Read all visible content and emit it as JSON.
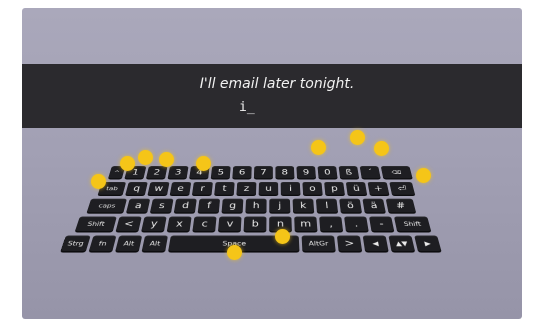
{
  "dictation": {
    "text": "I'll email later tonight.",
    "cursor": "i_"
  },
  "keyboard": {
    "rows": [
      [
        "^",
        "1",
        "2",
        "3",
        "4",
        "5",
        "6",
        "7",
        "8",
        "9",
        "0",
        "ß",
        "´",
        "⌫"
      ],
      [
        "tab",
        "q",
        "w",
        "e",
        "r",
        "t",
        "z",
        "u",
        "i",
        "o",
        "p",
        "ü",
        "+",
        "⏎"
      ],
      [
        "caps",
        "a",
        "s",
        "d",
        "f",
        "g",
        "h",
        "j",
        "k",
        "l",
        "ö",
        "ä",
        "#"
      ],
      [
        "Shift",
        "<",
        "y",
        "x",
        "c",
        "v",
        "b",
        "n",
        "m",
        ",",
        ".",
        "-",
        "Shift"
      ],
      [
        "Strg",
        "fn",
        "Alt",
        "Alt",
        "Space",
        "AltGr",
        ">",
        "◀",
        "▲▼",
        "▶"
      ]
    ]
  },
  "colors": {
    "marker": "#f5c518",
    "key_bg": "#1e1e22",
    "text_bar_bg": "#2b2a2e"
  }
}
